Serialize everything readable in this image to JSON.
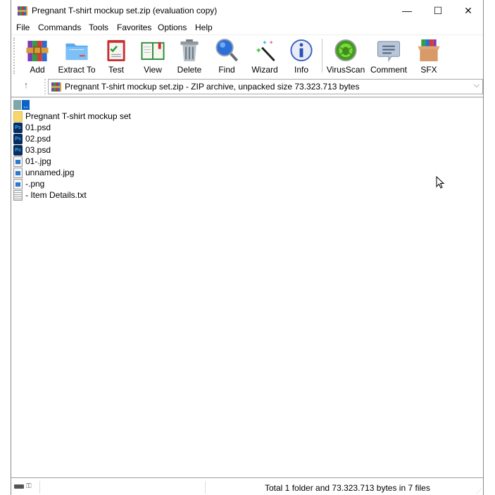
{
  "window": {
    "title": "Pregnant T-shirt mockup set.zip (evaluation copy)",
    "app_icon": "winrar-icon",
    "controls": {
      "minimize": "—",
      "maximize": "☐",
      "close": "✕"
    }
  },
  "menu": [
    {
      "label": "File"
    },
    {
      "label": "Commands"
    },
    {
      "label": "Tools"
    },
    {
      "label": "Favorites"
    },
    {
      "label": "Options"
    },
    {
      "label": "Help"
    }
  ],
  "toolbar": [
    {
      "label": "Add",
      "icon": "add-archive-icon"
    },
    {
      "label": "Extract To",
      "icon": "extract-folder-icon"
    },
    {
      "label": "Test",
      "icon": "test-clipboard-icon"
    },
    {
      "label": "View",
      "icon": "view-book-icon"
    },
    {
      "label": "Delete",
      "icon": "trash-icon"
    },
    {
      "label": "Find",
      "icon": "magnifier-icon"
    },
    {
      "label": "Wizard",
      "icon": "magic-wand-icon"
    },
    {
      "label": "Info",
      "icon": "info-icon"
    },
    {
      "label": "VirusScan",
      "icon": "virus-scan-icon"
    },
    {
      "label": "Comment",
      "icon": "comment-icon"
    },
    {
      "label": "SFX",
      "icon": "sfx-box-icon"
    }
  ],
  "address": {
    "up_symbol": "↑",
    "text": "Pregnant T-shirt mockup set.zip - ZIP archive, unpacked size 73.323.713 bytes",
    "chevron": "⌵"
  },
  "files": [
    {
      "name": "..",
      "type": "parent",
      "selected": true
    },
    {
      "name": "Pregnant T-shirt mockup set",
      "type": "folder"
    },
    {
      "name": "01.psd",
      "type": "psd"
    },
    {
      "name": "02.psd",
      "type": "psd"
    },
    {
      "name": "03.psd",
      "type": "psd"
    },
    {
      "name": "01-.jpg",
      "type": "image"
    },
    {
      "name": "unnamed.jpg",
      "type": "image"
    },
    {
      "name": "-.png",
      "type": "image"
    },
    {
      "name": "- Item Details.txt",
      "type": "text"
    }
  ],
  "status": {
    "text": "Total 1 folder and 73.323.713 bytes in 7 files",
    "resize_glyph": "⋰"
  },
  "colors": {
    "selection": "#0b63c9",
    "folder": "#f5d76e",
    "psd_bg": "#0a2e5c",
    "psd_text": "#31a8ff"
  }
}
